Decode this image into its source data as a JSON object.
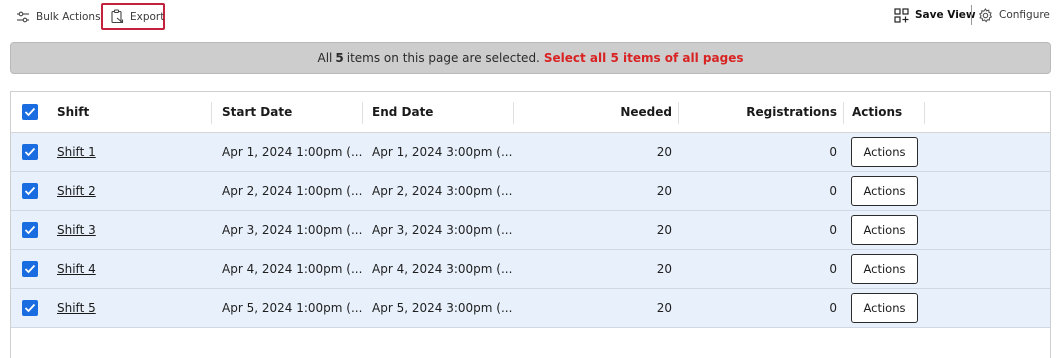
{
  "toolbar": {
    "bulk_actions_label": "Bulk Actions",
    "export_label": "Export",
    "save_view_label": "Save View",
    "configure_label": "Configure"
  },
  "banner": {
    "prefix": "All",
    "count": "5",
    "suffix": "items on this page are selected.",
    "select_all_link": "Select all 5 items of all pages"
  },
  "table": {
    "columns": {
      "shift": "Shift",
      "start_date": "Start Date",
      "end_date": "End Date",
      "needed": "Needed",
      "registrations": "Registrations",
      "actions": "Actions"
    },
    "rows": [
      {
        "shift": "Shift 1",
        "start": "Apr 1, 2024 1:00pm (...",
        "end": "Apr 1, 2024 3:00pm (...",
        "needed": "20",
        "registrations": "0",
        "action_label": "Actions",
        "selected": true
      },
      {
        "shift": "Shift 2",
        "start": "Apr 2, 2024 1:00pm (...",
        "end": "Apr 2, 2024 3:00pm (...",
        "needed": "20",
        "registrations": "0",
        "action_label": "Actions",
        "selected": true
      },
      {
        "shift": "Shift 3",
        "start": "Apr 3, 2024 1:00pm (...",
        "end": "Apr 3, 2024 3:00pm (...",
        "needed": "20",
        "registrations": "0",
        "action_label": "Actions",
        "selected": true
      },
      {
        "shift": "Shift 4",
        "start": "Apr 4, 2024 1:00pm (...",
        "end": "Apr 4, 2024 3:00pm (...",
        "needed": "20",
        "registrations": "0",
        "action_label": "Actions",
        "selected": true
      },
      {
        "shift": "Shift 5",
        "start": "Apr 5, 2024 1:00pm (...",
        "end": "Apr 5, 2024 3:00pm (...",
        "needed": "20",
        "registrations": "0",
        "action_label": "Actions",
        "selected": true
      }
    ]
  },
  "colors": {
    "accent": "#1a6de0",
    "highlight_border": "#c4213f",
    "link_red": "#d92323",
    "selected_row_bg": "#e8f0fb",
    "banner_bg": "#cdcdcd"
  },
  "icons": [
    "sliders-icon",
    "clipboard-export-icon",
    "save-view-grid-icon",
    "gear-icon",
    "checkmark-icon"
  ]
}
